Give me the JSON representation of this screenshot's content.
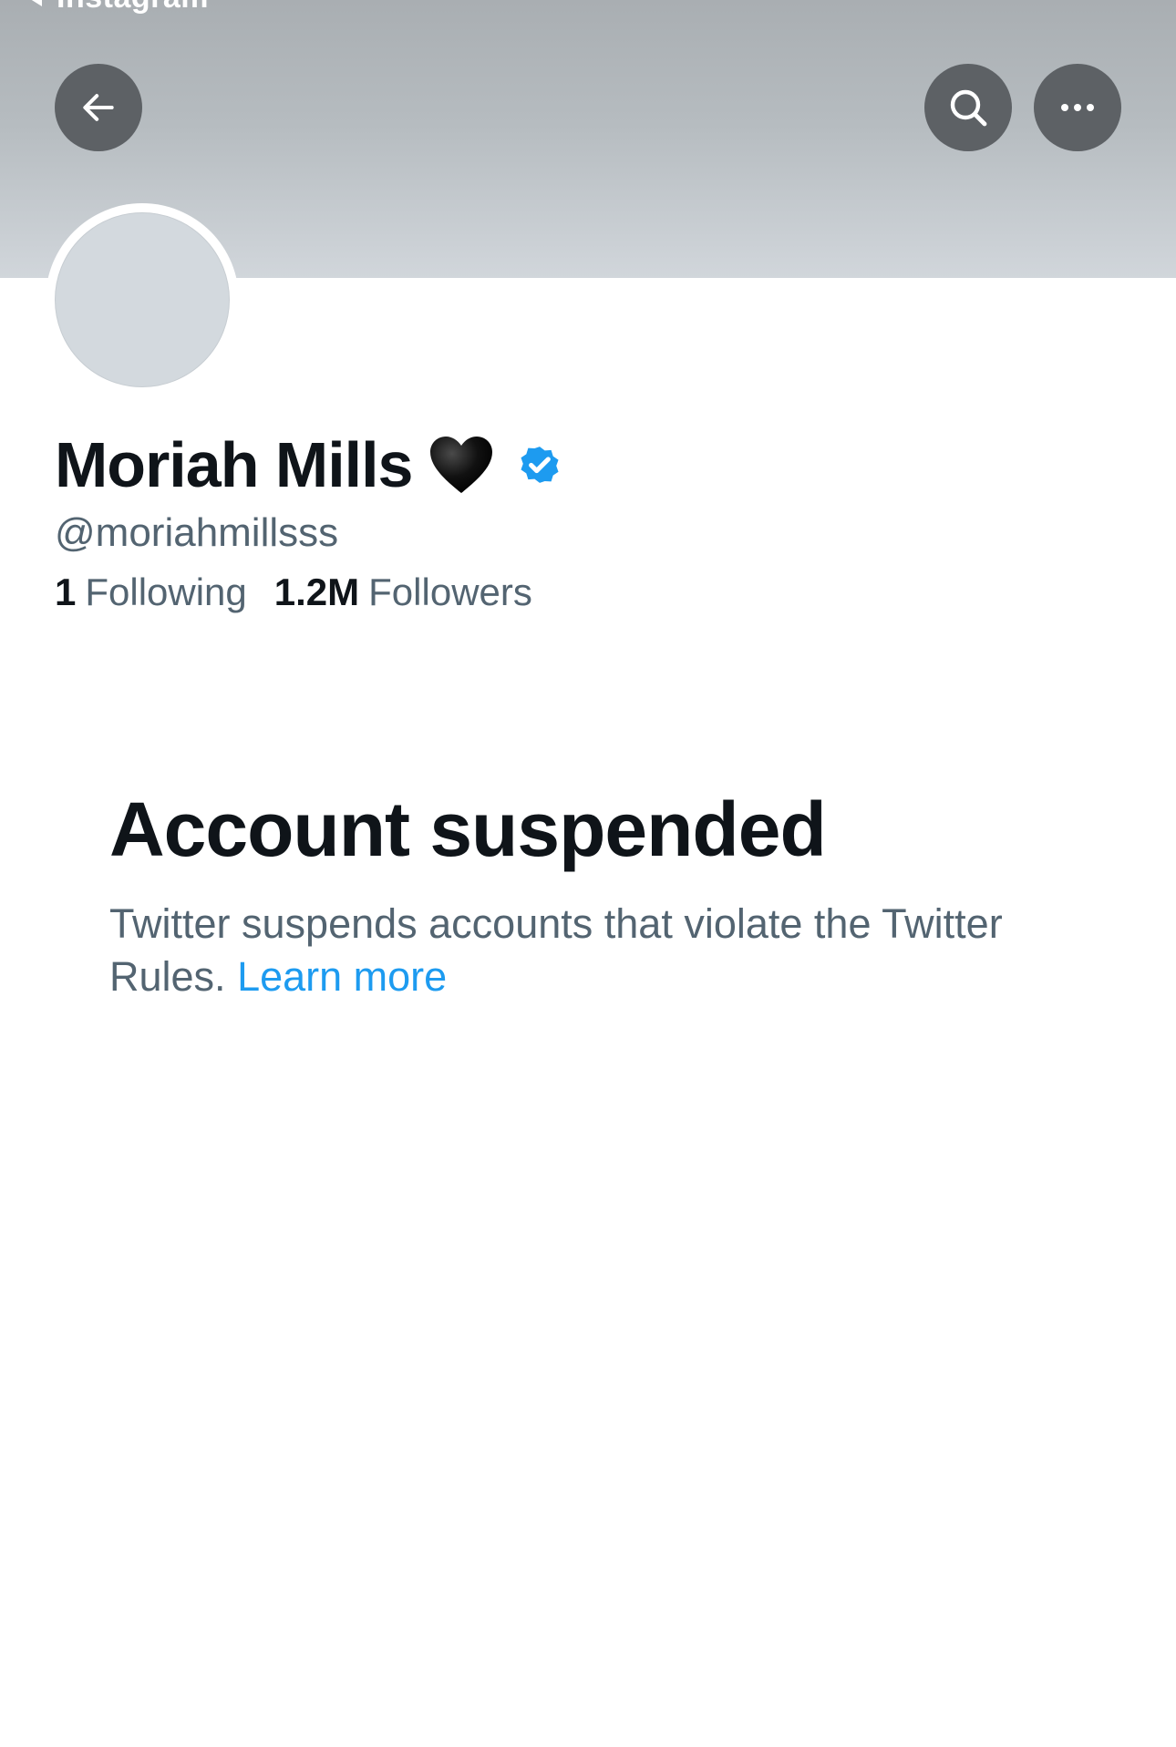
{
  "status_bar": {
    "back_app_label": "Instagram"
  },
  "header": {
    "back_icon": "arrow-left-icon",
    "search_icon": "search-icon",
    "more_icon": "more-horizontal-icon"
  },
  "profile": {
    "display_name": "Moriah Mills",
    "name_emoji": "black-heart-icon",
    "verified_icon": "verified-badge-icon",
    "verified_color": "#1d9bf0",
    "handle": "@moriahmillsss",
    "following_count": "1",
    "following_label": "Following",
    "followers_count": "1.2M",
    "followers_label": "Followers"
  },
  "notice": {
    "title": "Account suspended",
    "body": "Twitter suspends accounts that violate the Twitter Rules.",
    "link_label": "Learn more",
    "link_color": "#1d9bf0"
  },
  "colors": {
    "primary_text": "#0f1419",
    "secondary_text": "#536471",
    "button_bg": "#5d6165"
  }
}
